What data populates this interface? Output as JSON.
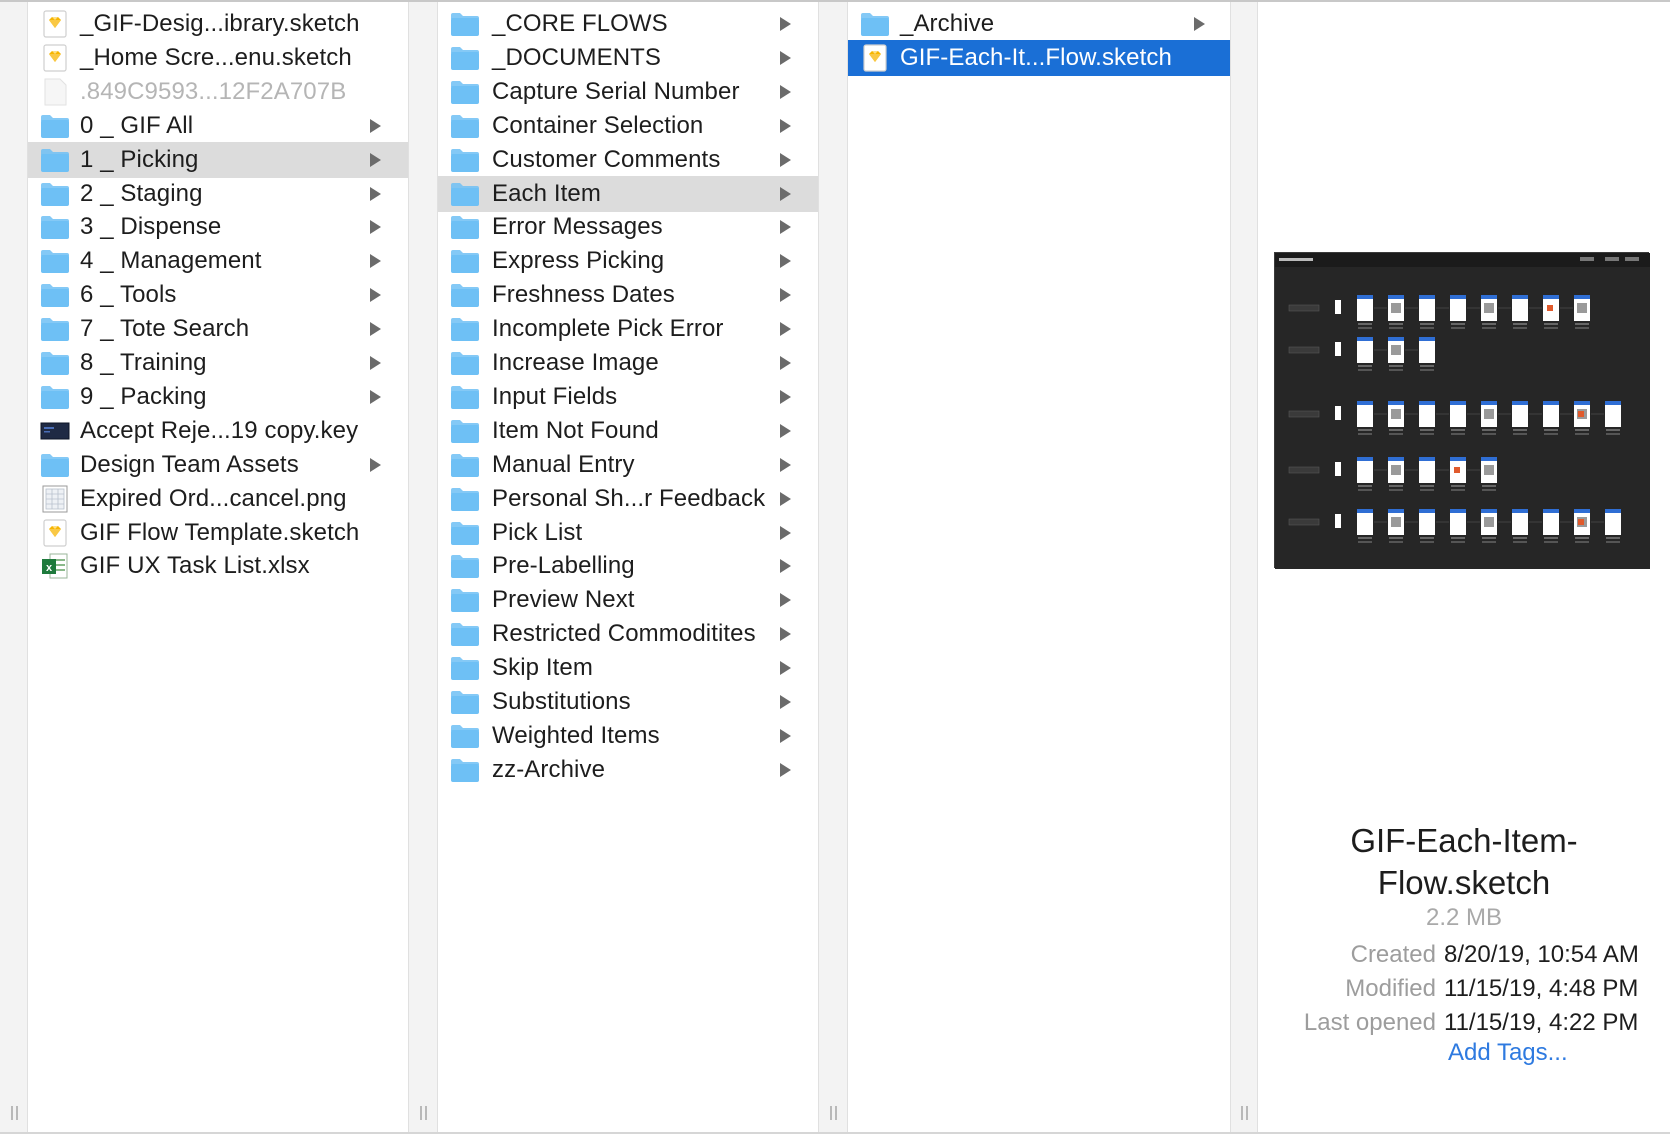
{
  "columns": [
    {
      "items": [
        {
          "label": "_GIF-Desig...ibrary.sketch",
          "icon": "sketch-file-icon",
          "arrow": false,
          "state": "normal"
        },
        {
          "label": "_Home Scre...enu.sketch",
          "icon": "sketch-file-icon",
          "arrow": false,
          "state": "normal"
        },
        {
          "label": ".849C9593...12F2A707B",
          "icon": "blank-file-icon",
          "arrow": false,
          "state": "dim"
        },
        {
          "label": "0 _ GIF All",
          "icon": "folder-icon",
          "arrow": true,
          "state": "normal"
        },
        {
          "label": "1 _ Picking",
          "icon": "folder-icon",
          "arrow": true,
          "state": "selected-inactive"
        },
        {
          "label": "2 _ Staging",
          "icon": "folder-icon",
          "arrow": true,
          "state": "normal"
        },
        {
          "label": "3 _ Dispense",
          "icon": "folder-icon",
          "arrow": true,
          "state": "normal"
        },
        {
          "label": "4 _ Management",
          "icon": "folder-icon",
          "arrow": true,
          "state": "normal"
        },
        {
          "label": "6 _ Tools",
          "icon": "folder-icon",
          "arrow": true,
          "state": "normal"
        },
        {
          "label": "7 _ Tote Search",
          "icon": "folder-icon",
          "arrow": true,
          "state": "normal"
        },
        {
          "label": "8 _ Training",
          "icon": "folder-icon",
          "arrow": true,
          "state": "normal"
        },
        {
          "label": "9 _ Packing",
          "icon": "folder-icon",
          "arrow": true,
          "state": "normal"
        },
        {
          "label": "Accept Reje...19 copy.key",
          "icon": "keynote-file-icon",
          "arrow": false,
          "state": "normal"
        },
        {
          "label": "Design Team Assets",
          "icon": "folder-icon",
          "arrow": true,
          "state": "normal"
        },
        {
          "label": "Expired Ord...cancel.png",
          "icon": "png-file-icon",
          "arrow": false,
          "state": "normal"
        },
        {
          "label": "GIF Flow Template.sketch",
          "icon": "sketch-file-icon",
          "arrow": false,
          "state": "normal"
        },
        {
          "label": "GIF UX Task List.xlsx",
          "icon": "excel-file-icon",
          "arrow": false,
          "state": "normal"
        }
      ]
    },
    {
      "items": [
        {
          "label": "_CORE FLOWS",
          "icon": "folder-icon",
          "arrow": true,
          "state": "normal"
        },
        {
          "label": "_DOCUMENTS",
          "icon": "folder-icon",
          "arrow": true,
          "state": "normal"
        },
        {
          "label": "Capture Serial Number",
          "icon": "folder-icon",
          "arrow": true,
          "state": "normal"
        },
        {
          "label": "Container Selection",
          "icon": "folder-icon",
          "arrow": true,
          "state": "normal"
        },
        {
          "label": "Customer Comments",
          "icon": "folder-icon",
          "arrow": true,
          "state": "normal"
        },
        {
          "label": "Each Item",
          "icon": "folder-icon",
          "arrow": true,
          "state": "selected-inactive"
        },
        {
          "label": "Error Messages",
          "icon": "folder-icon",
          "arrow": true,
          "state": "normal"
        },
        {
          "label": "Express Picking",
          "icon": "folder-icon",
          "arrow": true,
          "state": "normal"
        },
        {
          "label": "Freshness Dates",
          "icon": "folder-icon",
          "arrow": true,
          "state": "normal"
        },
        {
          "label": "Incomplete Pick Error",
          "icon": "folder-icon",
          "arrow": true,
          "state": "normal"
        },
        {
          "label": "Increase Image",
          "icon": "folder-icon",
          "arrow": true,
          "state": "normal"
        },
        {
          "label": "Input Fields",
          "icon": "folder-icon",
          "arrow": true,
          "state": "normal"
        },
        {
          "label": "Item Not Found",
          "icon": "folder-icon",
          "arrow": true,
          "state": "normal"
        },
        {
          "label": "Manual Entry",
          "icon": "folder-icon",
          "arrow": true,
          "state": "normal"
        },
        {
          "label": "Personal Sh...r Feedback",
          "icon": "folder-icon",
          "arrow": true,
          "state": "normal"
        },
        {
          "label": "Pick List",
          "icon": "folder-icon",
          "arrow": true,
          "state": "normal"
        },
        {
          "label": "Pre-Labelling",
          "icon": "folder-icon",
          "arrow": true,
          "state": "normal"
        },
        {
          "label": "Preview Next",
          "icon": "folder-icon",
          "arrow": true,
          "state": "normal"
        },
        {
          "label": "Restricted Commoditites",
          "icon": "folder-icon",
          "arrow": true,
          "state": "normal"
        },
        {
          "label": "Skip Item",
          "icon": "folder-icon",
          "arrow": true,
          "state": "normal"
        },
        {
          "label": "Substitutions",
          "icon": "folder-icon",
          "arrow": true,
          "state": "normal"
        },
        {
          "label": "Weighted Items",
          "icon": "folder-icon",
          "arrow": true,
          "state": "normal"
        },
        {
          "label": "zz-Archive",
          "icon": "folder-icon",
          "arrow": true,
          "state": "normal"
        }
      ]
    },
    {
      "items": [
        {
          "label": "_Archive",
          "icon": "folder-icon",
          "arrow": true,
          "state": "normal"
        },
        {
          "label": "GIF-Each-It...Flow.sketch",
          "icon": "sketch-file-icon",
          "arrow": false,
          "state": "selected-active"
        }
      ]
    }
  ],
  "preview": {
    "name_line1": "GIF-Each-Item-",
    "name_line2": "Flow.sketch",
    "size": "2.2 MB",
    "created_label": "Created",
    "created_value": "8/20/19, 10:54 AM",
    "modified_label": "Modified",
    "modified_value": "11/15/19, 4:48 PM",
    "opened_label": "Last opened",
    "opened_value": "11/15/19, 4:22 PM",
    "add_tags": "Add Tags..."
  },
  "colors": {
    "folder": "#6ec0f5",
    "selection_active": "#1a6fd6",
    "selection_inactive": "#dcdcdc",
    "link": "#2e7ae0"
  }
}
